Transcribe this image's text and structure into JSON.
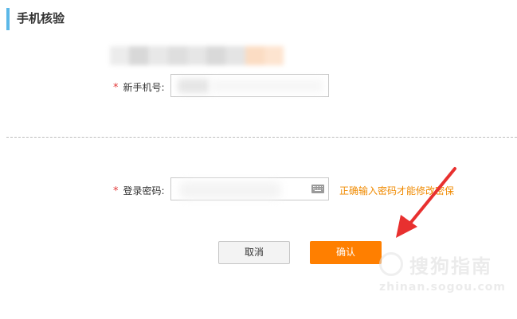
{
  "header": {
    "title": "手机核验"
  },
  "phone_row": {
    "required_mark": "*",
    "label": "新手机号:"
  },
  "password_row": {
    "required_mark": "*",
    "label": "登录密码:",
    "hint": "正确输入密码才能修改密保"
  },
  "buttons": {
    "cancel": "取消",
    "confirm": "确认"
  },
  "watermark": {
    "brand": "搜狗指南",
    "url": "zhinan.sogou.com"
  },
  "colors": {
    "accent_bar": "#5bb8e8",
    "confirm_button": "#ff7f00",
    "hint_text": "#f08a00",
    "required": "#e23b3b",
    "arrow": "#e8302f"
  }
}
